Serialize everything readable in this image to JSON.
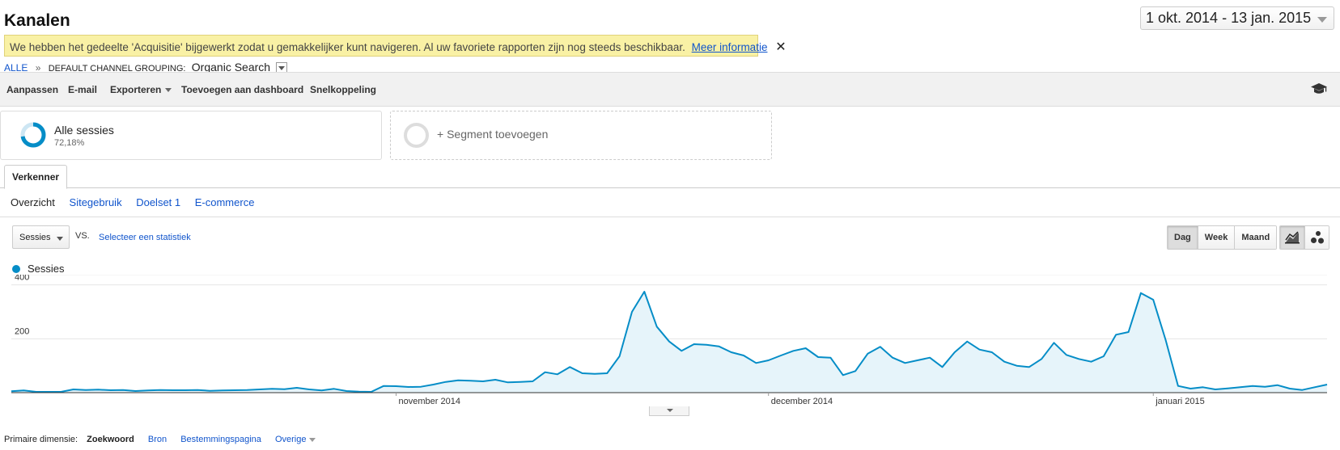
{
  "page": {
    "title": "Kanalen"
  },
  "date_range": {
    "label": "1 okt. 2014 - 13 jan. 2015"
  },
  "notice": {
    "text": "We hebben het gedeelte 'Acquisitie' bijgewerkt zodat u gemakkelijker kunt navigeren. Al uw favoriete rapporten zijn nog steeds beschikbaar.",
    "link": "Meer informatie",
    "close": "✕"
  },
  "breadcrumb": {
    "root": "ALLE",
    "separator": "»",
    "dimension": "DEFAULT CHANNEL GROUPING:",
    "value": "Organic Search"
  },
  "toolbar": {
    "customize": "Aanpassen",
    "email": "E-mail",
    "export": "Exporteren",
    "add_dashboard": "Toevoegen aan dashboard",
    "shortcut": "Snelkoppeling",
    "help_icon": "graduation-cap-icon"
  },
  "segments": {
    "active": {
      "name": "Alle sessies",
      "percent": "72,18%",
      "fraction": 0.7218
    },
    "add_label": "+ Segment toevoegen"
  },
  "tabs": {
    "explorer": "Verkenner"
  },
  "subtabs": [
    "Overzicht",
    "Sitegebruik",
    "Doelset 1",
    "E-commerce"
  ],
  "metric": {
    "selected": "Sessies",
    "vs": "VS.",
    "select_second": "Selecteer een statistiek"
  },
  "period_buttons": [
    "Dag",
    "Week",
    "Maand"
  ],
  "period_active": "Dag",
  "view_buttons": [
    "line-chart-icon",
    "motion-chart-icon"
  ],
  "colors": {
    "accent": "#058dc7",
    "area_fill": "#e6f4fa",
    "link": "#1155cc",
    "notice_bg": "#f9f1a5"
  },
  "chart_data": {
    "type": "area",
    "series": [
      {
        "name": "Sessies",
        "color": "#058dc7",
        "values": [
          5,
          8,
          3,
          3,
          3,
          12,
          10,
          11,
          9,
          10,
          6,
          8,
          10,
          9,
          9,
          10,
          7,
          8,
          9,
          10,
          12,
          14,
          13,
          18,
          12,
          8,
          14,
          6,
          4,
          3,
          25,
          24,
          21,
          22,
          30,
          40,
          46,
          44,
          42,
          48,
          38,
          40,
          42,
          76,
          68,
          95,
          72,
          70,
          72,
          135,
          300,
          375,
          245,
          190,
          155,
          180,
          178,
          172,
          150,
          138,
          110,
          120,
          138,
          155,
          165,
          132,
          130,
          65,
          80,
          145,
          170,
          130,
          110,
          120,
          130,
          95,
          150,
          190,
          160,
          150,
          115,
          100,
          95,
          125,
          185,
          140,
          125,
          115,
          135,
          215,
          225,
          370,
          345,
          195,
          25,
          15,
          20,
          12,
          16,
          20,
          25,
          22,
          28,
          15,
          10,
          20,
          30
        ]
      }
    ],
    "x_start": "2014-10-01",
    "x_end": "2015-01-13",
    "x_tick_labels": [
      "november 2014",
      "december 2014",
      "januari 2015"
    ],
    "y_ticks": [
      200,
      400
    ],
    "ylim": [
      0,
      420
    ],
    "grid": true,
    "legend": "top-left"
  },
  "primary_dimension": {
    "label": "Primaire dimensie:",
    "active": "Zoekwoord",
    "options": [
      "Bron",
      "Bestemmingspagina"
    ],
    "other": "Overige"
  }
}
